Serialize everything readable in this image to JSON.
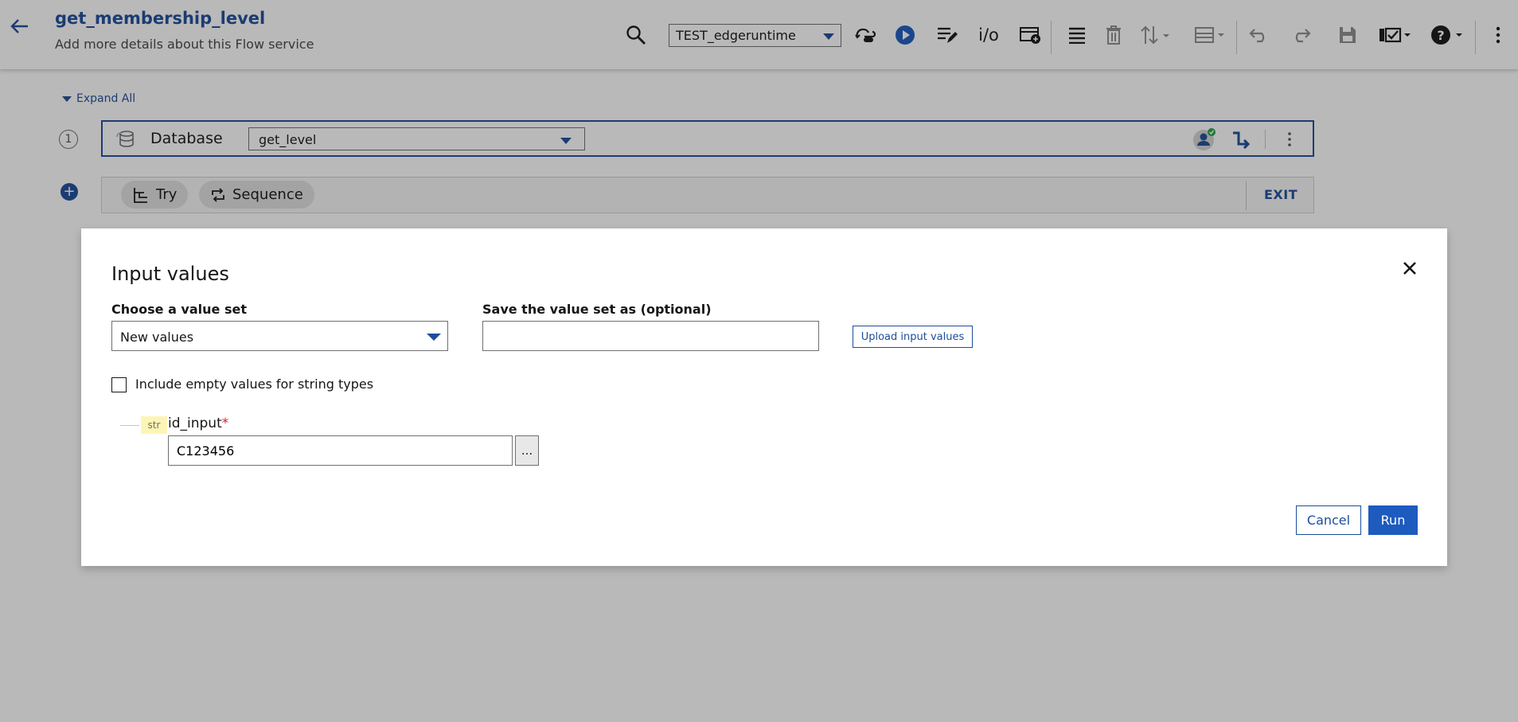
{
  "header": {
    "title": "get_membership_level",
    "subtitle": "Add more details about this Flow service",
    "environment": "TEST_edgeruntime",
    "io_label": "i/o",
    "toolbar_icons": [
      "back-arrow-icon",
      "search-icon",
      "cloud-sync-icon",
      "run-icon",
      "edit-mapping-icon",
      "io-icon",
      "debug-icon",
      "list-icon",
      "delete-icon",
      "sort-icon",
      "layout-icon",
      "undo-icon",
      "redo-icon",
      "save-icon",
      "view-icon",
      "help-icon",
      "overflow-menu-icon"
    ]
  },
  "canvas": {
    "expand_all": "Expand All",
    "step_number": "1",
    "step": {
      "connector": "Database",
      "operation": "get_level"
    },
    "controls": {
      "try_label": "Try",
      "sequence_label": "Sequence",
      "exit_label": "EXIT"
    }
  },
  "modal": {
    "title": "Input values",
    "value_set_label": "Choose a value set",
    "value_set_selected": "New values",
    "save_label": "Save the value set as (optional)",
    "save_value": "",
    "upload_label": "Upload input values",
    "checkbox_label": "Include empty values for string types",
    "checkbox_checked": false,
    "field": {
      "type": "str",
      "name": "id_input",
      "required_mark": "*",
      "value": "C123456",
      "more_label": "..."
    },
    "cancel_label": "Cancel",
    "run_label": "Run"
  },
  "colors": {
    "accent": "#1d4d9a",
    "primary_button": "#1d5bbf",
    "badge_bg": "#fdf5b5",
    "required": "#da1e28"
  }
}
